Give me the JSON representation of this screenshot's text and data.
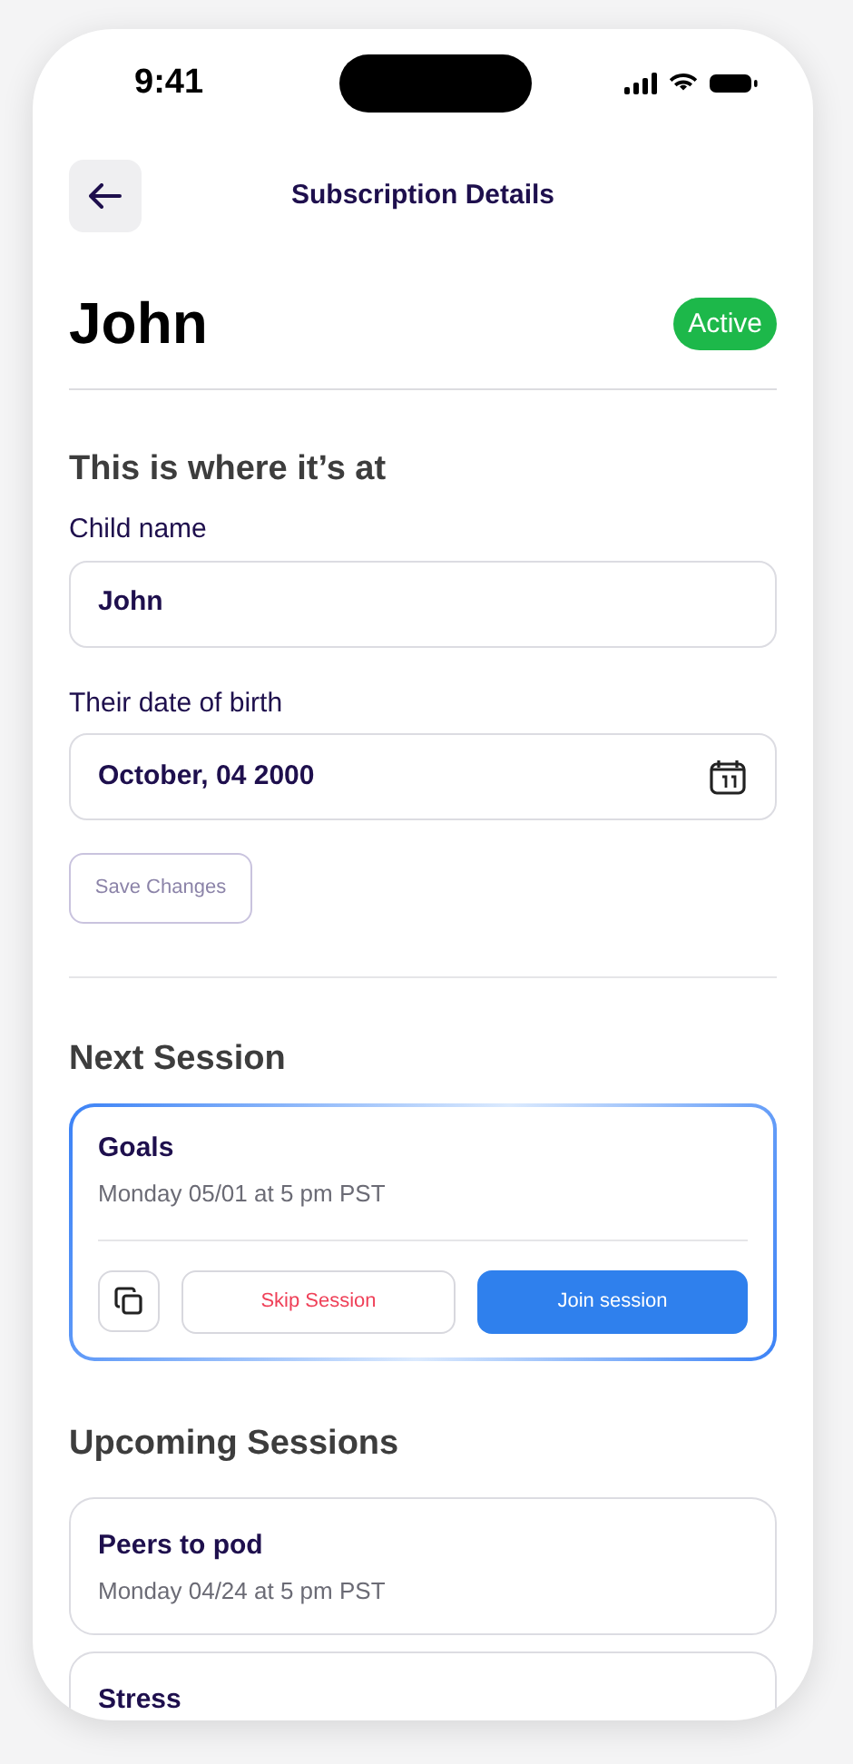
{
  "status_bar": {
    "time": "9:41"
  },
  "header": {
    "title": "Subscription Details"
  },
  "subscription": {
    "name": "John",
    "status": "Active",
    "active": true
  },
  "form": {
    "heading": "This is where it’s at",
    "fields": [
      {
        "kind": "text",
        "label": "Child name",
        "value": "John"
      },
      {
        "kind": "date",
        "label": "Their date of birth",
        "value": "October, 04 2000"
      }
    ],
    "save_button": {
      "label": "Save Changes",
      "disabled": true
    }
  },
  "next_session": {
    "heading": "Next Session",
    "title": "Goals",
    "time": "Monday 05/01 at 5 pm PST",
    "skip_button": "Skip Session",
    "join_button": "Join session"
  },
  "upcoming": {
    "heading": "Upcoming Sessions",
    "sessions": [
      {
        "title": "Peers to pod",
        "time": "Monday 04/24 at 5 pm PST"
      },
      {
        "title": "Stress"
      }
    ]
  }
}
